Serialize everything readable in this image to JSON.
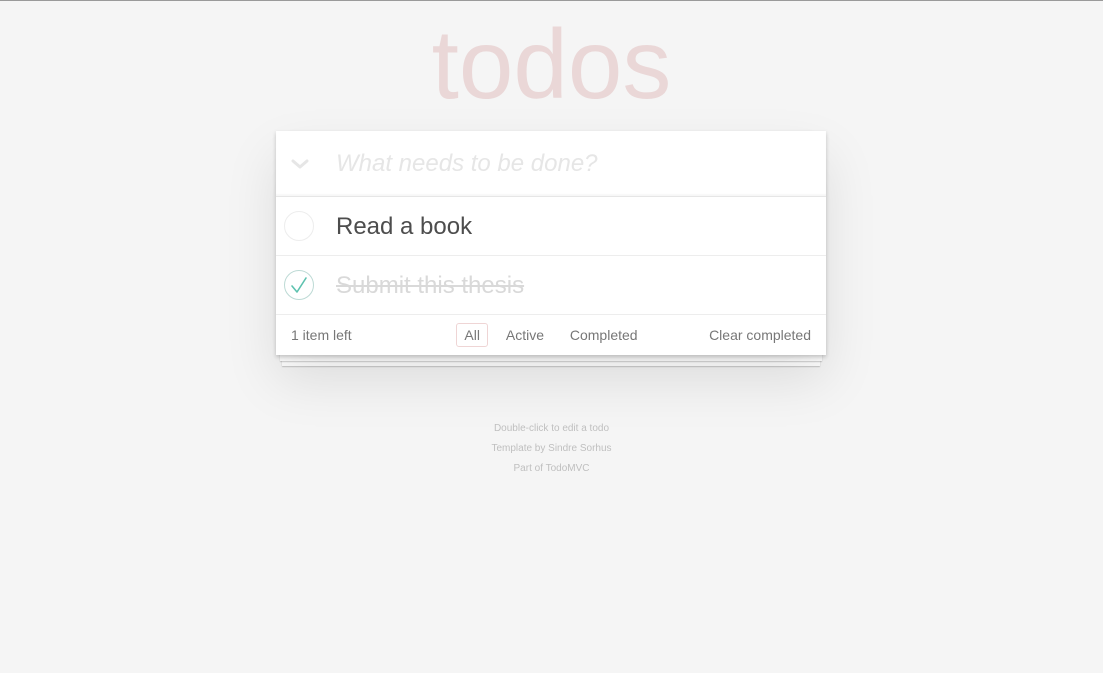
{
  "title": "todos",
  "new_todo": {
    "placeholder": "What needs to be done?"
  },
  "toggle_all_icon": "chevron-down-icon",
  "todos": [
    {
      "label": "Read a book",
      "completed": false
    },
    {
      "label": "Submit this thesis",
      "completed": true
    }
  ],
  "footer": {
    "count_text": "1 item left",
    "filters": [
      "All",
      "Active",
      "Completed"
    ],
    "selected_filter": "All",
    "clear_label": "Clear completed"
  },
  "info": {
    "line1": "Double-click to edit a todo",
    "line2": "Template by Sindre Sorhus",
    "line3": "Part of TodoMVC"
  },
  "colors": {
    "title": "#efd5d5",
    "check": "#5dc2af",
    "background": "#f5f5f5"
  }
}
